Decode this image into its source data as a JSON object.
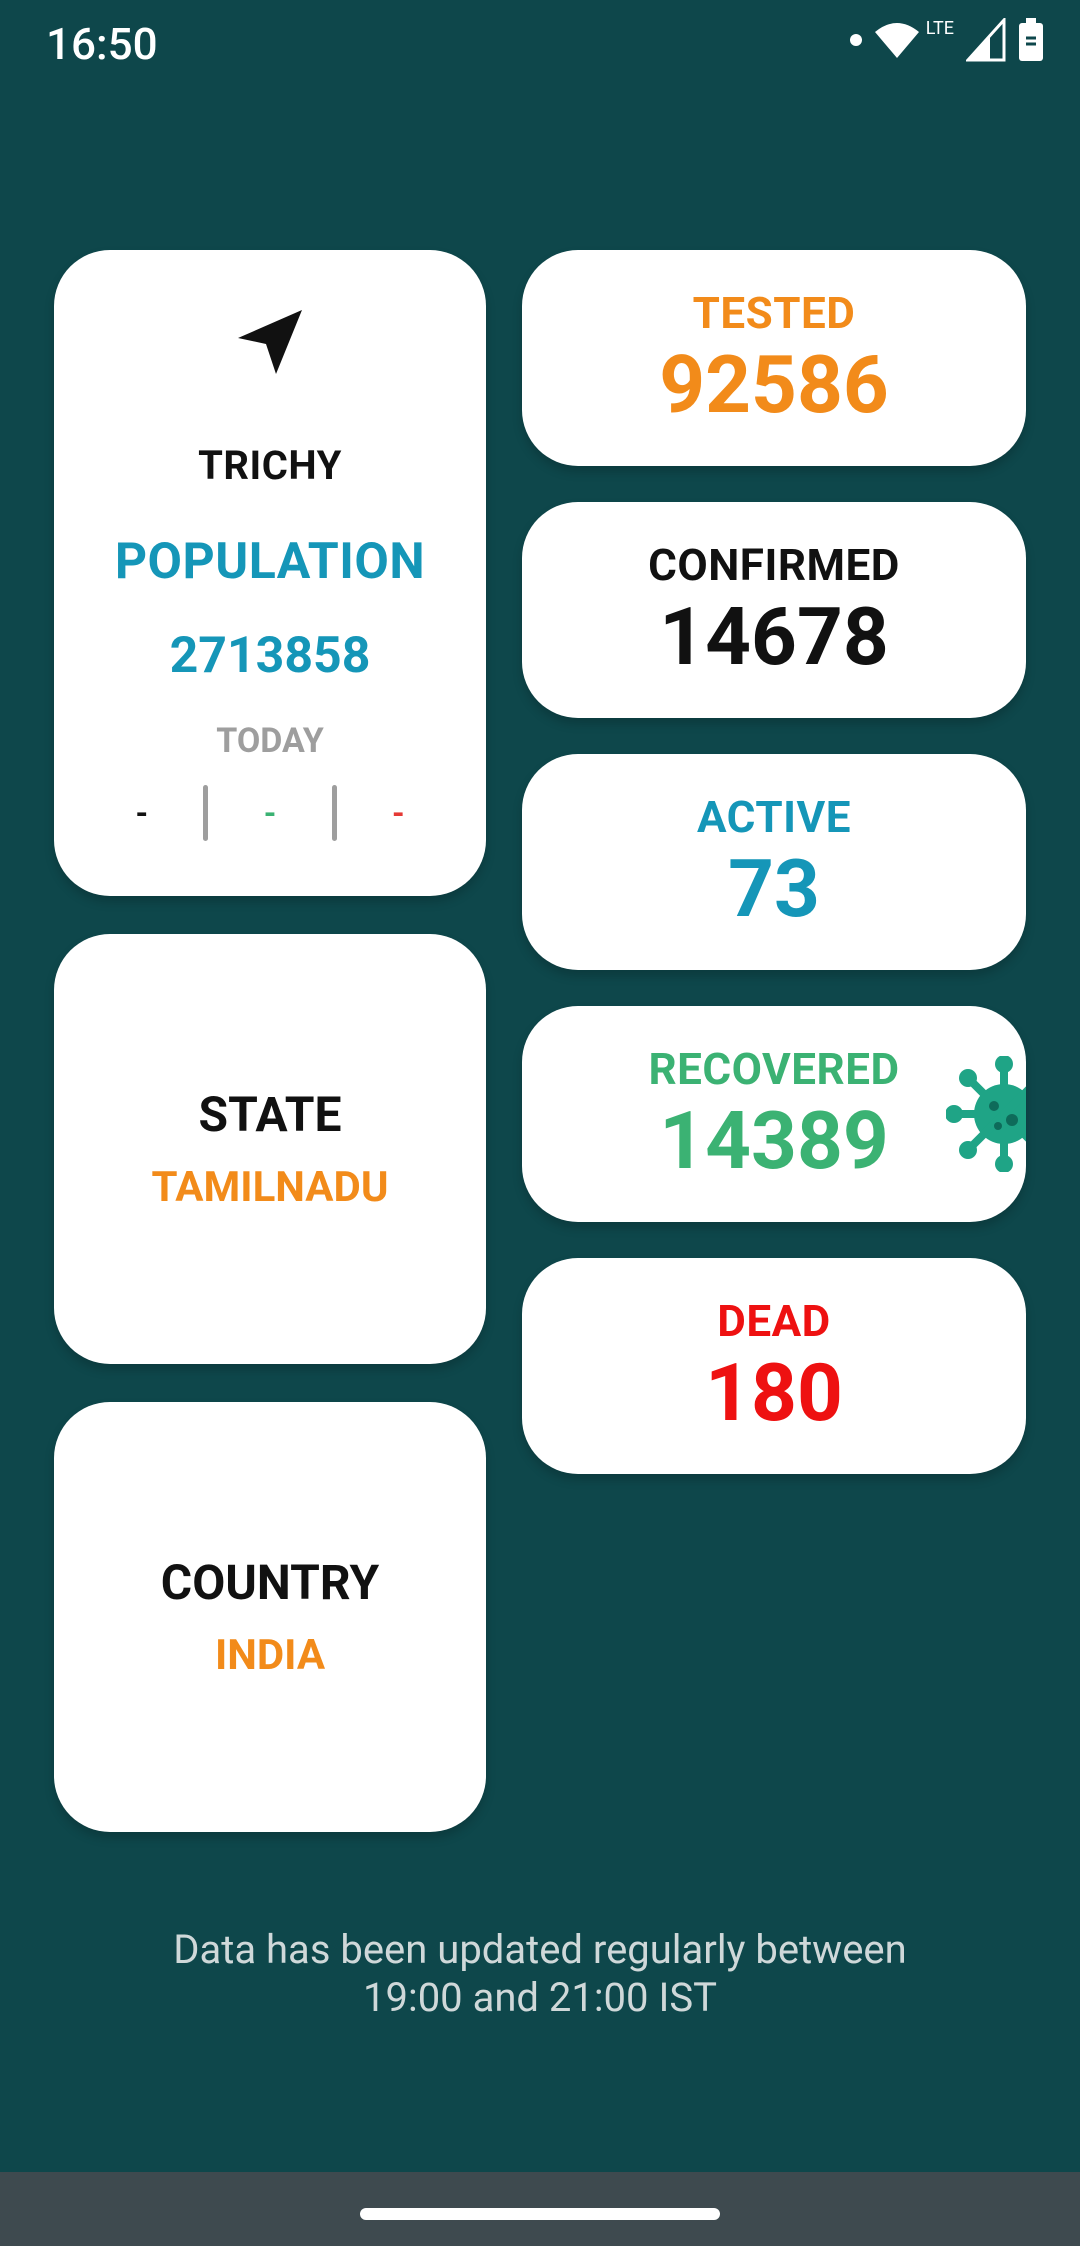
{
  "status_bar": {
    "time": "16:50",
    "network_label": "LTE"
  },
  "city": {
    "name": "TRICHY",
    "population_label": "POPULATION",
    "population_value": "2713858",
    "today_label": "TODAY",
    "today_values": [
      "-",
      "-",
      "-"
    ],
    "today_colors": [
      "#111111",
      "#3bb273",
      "#e53935"
    ]
  },
  "state": {
    "title": "STATE",
    "value": "TAMILNADU"
  },
  "country": {
    "title": "COUNTRY",
    "value": "INDIA"
  },
  "stats": {
    "tested": {
      "label": "TESTED",
      "value": "92586",
      "color": "#f28b1a"
    },
    "confirmed": {
      "label": "CONFIRMED",
      "value": "14678",
      "color": "#111111"
    },
    "active": {
      "label": "ACTIVE",
      "value": "73",
      "color": "#1596b8"
    },
    "recovered": {
      "label": "RECOVERED",
      "value": "14389",
      "color": "#3bb273"
    },
    "dead": {
      "label": "DEAD",
      "value": "180",
      "color": "#ee1111"
    }
  },
  "footer": {
    "line1": "Data has been updated regularly between",
    "line2": "19:00 and 21:00 IST"
  },
  "icons": {
    "location": "navigation-arrow-icon",
    "virus": "virus-icon",
    "wifi": "wifi-icon",
    "signal": "signal-icon",
    "battery": "battery-icon"
  }
}
